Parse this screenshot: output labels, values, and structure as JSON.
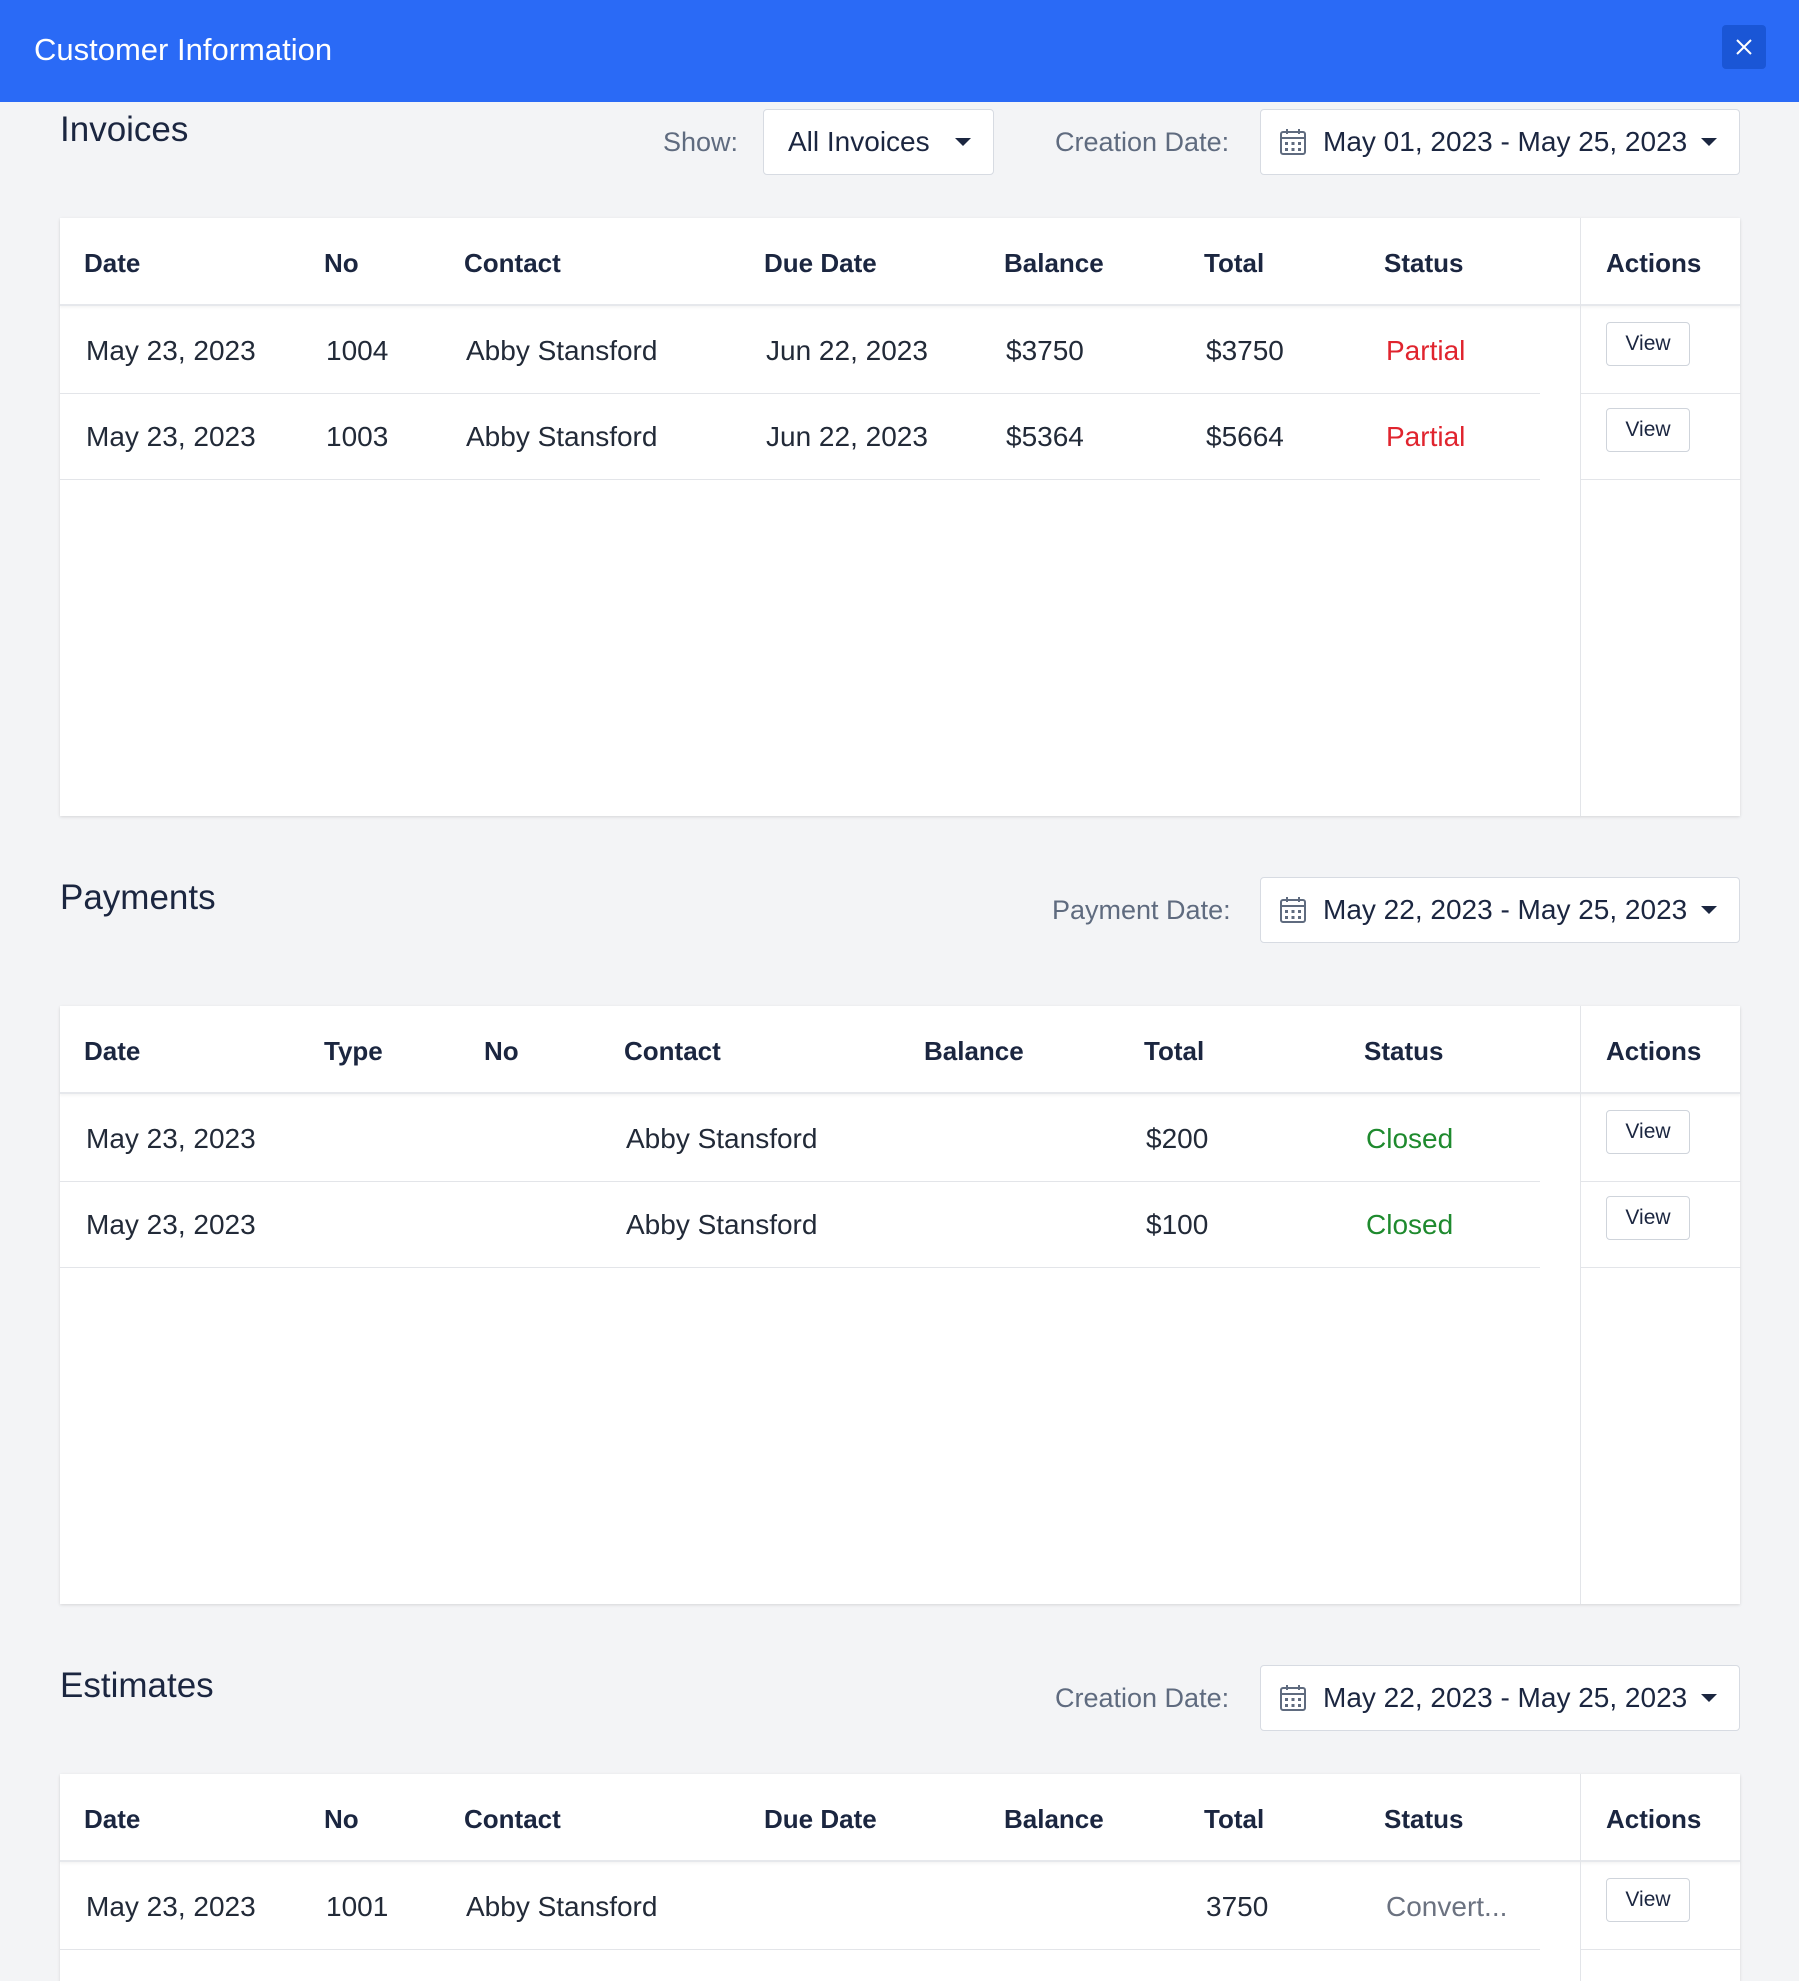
{
  "header": {
    "title": "Customer Information",
    "close_icon": "close-icon"
  },
  "colors": {
    "header_bg": "#2a6af6",
    "partial": "#e0242e",
    "closed": "#1e8a2e",
    "converted": "#6b7280"
  },
  "invoices": {
    "title": "Invoices",
    "show_label": "Show:",
    "show_value": "All Invoices",
    "date_label": "Creation Date:",
    "date_value": "May 01, 2023 - May 25, 2023",
    "columns": [
      "Date",
      "No",
      "Contact",
      "Due Date",
      "Balance",
      "Total",
      "Status",
      "Actions"
    ],
    "rows": [
      {
        "date": "May 23, 2023",
        "no": "1004",
        "contact": "Abby Stansford",
        "due": "Jun 22, 2023",
        "balance": "$3750",
        "total": "$3750",
        "status": "Partial",
        "action": "View"
      },
      {
        "date": "May 23, 2023",
        "no": "1003",
        "contact": "Abby Stansford",
        "due": "Jun 22, 2023",
        "balance": "$5364",
        "total": "$5664",
        "status": "Partial",
        "action": "View"
      }
    ]
  },
  "payments": {
    "title": "Payments",
    "date_label": "Payment Date:",
    "date_value": "May 22, 2023 - May 25, 2023",
    "columns": [
      "Date",
      "Type",
      "No",
      "Contact",
      "Balance",
      "Total",
      "Status",
      "Actions"
    ],
    "rows": [
      {
        "date": "May 23, 2023",
        "type": "",
        "no": "",
        "contact": "Abby Stansford",
        "balance": "",
        "total": "$200",
        "status": "Closed",
        "action": "View"
      },
      {
        "date": "May 23, 2023",
        "type": "",
        "no": "",
        "contact": "Abby Stansford",
        "balance": "",
        "total": "$100",
        "status": "Closed",
        "action": "View"
      }
    ]
  },
  "estimates": {
    "title": "Estimates",
    "date_label": "Creation Date:",
    "date_value": "May 22, 2023 - May 25, 2023",
    "columns": [
      "Date",
      "No",
      "Contact",
      "Due Date",
      "Balance",
      "Total",
      "Status",
      "Actions"
    ],
    "rows": [
      {
        "date": "May 23, 2023",
        "no": "1001",
        "contact": "Abby Stansford",
        "due": "",
        "balance": "",
        "total": "3750",
        "status": "Convert...",
        "action": "View"
      }
    ]
  }
}
